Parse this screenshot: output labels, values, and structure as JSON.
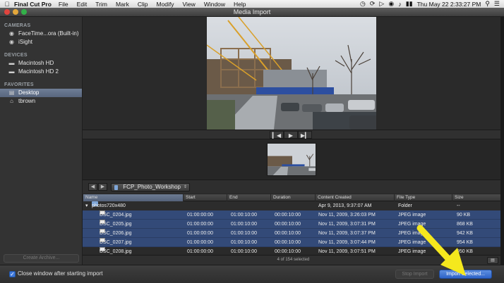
{
  "menubar": {
    "app": "Final Cut Pro",
    "items": [
      "File",
      "Edit",
      "Trim",
      "Mark",
      "Clip",
      "Modify",
      "View",
      "Window",
      "Help"
    ],
    "clock": "Thu May 22  2:33:27 PM",
    "icons": [
      "apple-icon",
      "time-machine-icon",
      "sync-icon",
      "airplay-icon",
      "wifi-icon",
      "volume-icon",
      "battery-icon",
      "spotlight-icon",
      "list-icon"
    ]
  },
  "window": {
    "title": "Media Import",
    "traffic_lights": [
      "#e0443e",
      "#e2a73b",
      "#33b149"
    ]
  },
  "sidebar": {
    "sections": [
      {
        "header": "CAMERAS",
        "items": [
          {
            "label": "FaceTime...ora (Built-in)",
            "icon": "camera-icon"
          },
          {
            "label": "iSight",
            "icon": "camera-icon"
          }
        ]
      },
      {
        "header": "DEVICES",
        "items": [
          {
            "label": "Macintosh HD",
            "icon": "drive-icon"
          },
          {
            "label": "Macintosh HD 2",
            "icon": "drive-icon"
          }
        ]
      },
      {
        "header": "FAVORITES",
        "items": [
          {
            "label": "Desktop",
            "icon": "desktop-icon",
            "selected": true
          },
          {
            "label": "tbrown",
            "icon": "home-icon"
          }
        ]
      }
    ],
    "create_archive": "Create Archive..."
  },
  "viewer": {
    "transport": [
      "previous-icon",
      "play-icon",
      "next-icon"
    ]
  },
  "pathbar": {
    "folder": "FCP_Photo_Workshop"
  },
  "table": {
    "columns": [
      "Name",
      "Start",
      "End",
      "Duration",
      "Content Created",
      "File Type",
      "Size"
    ],
    "folder_row": {
      "name": "photos720x480",
      "content_created": "Apr 9, 2013, 9:37:07 AM",
      "file_type": "Folder",
      "size": "--"
    },
    "rows": [
      {
        "name": "DSC_0204.jpg",
        "start": "01:00:00:00",
        "end": "01:00:10:00",
        "duration": "00:00:10:00",
        "created": "Nov 11, 2009, 3:26:03 PM",
        "type": "JPEG image",
        "size": "90 KB"
      },
      {
        "name": "DSC_0205.jpg",
        "start": "01:00:00:00",
        "end": "01:00:10:00",
        "duration": "00:00:10:00",
        "created": "Nov 11, 2009, 3:07:31 PM",
        "type": "JPEG image",
        "size": "868 KB"
      },
      {
        "name": "DSC_0206.jpg",
        "start": "01:00:00:00",
        "end": "01:00:10:00",
        "duration": "00:00:10:00",
        "created": "Nov 11, 2009, 3:07:37 PM",
        "type": "JPEG image",
        "size": "942 KB"
      },
      {
        "name": "DSC_0207.jpg",
        "start": "01:00:00:00",
        "end": "01:00:10:00",
        "duration": "00:00:10:00",
        "created": "Nov 11, 2009, 3:07:44 PM",
        "type": "JPEG image",
        "size": "954 KB"
      },
      {
        "name": "DSC_0208.jpg",
        "start": "01:00:00:00",
        "end": "01:00:10:00",
        "duration": "00:00:10:00",
        "created": "Nov 11, 2009, 3:07:51 PM",
        "type": "JPEG image",
        "size": "950 KB"
      }
    ]
  },
  "status": {
    "selected": "4 of 154 selected"
  },
  "footer": {
    "close_window_label": "Close window after starting import",
    "close_window_checked": true,
    "stop_import": "Stop Import",
    "import_selected": "Import Selected..."
  },
  "annotation": {
    "color": "#f5e81d"
  }
}
